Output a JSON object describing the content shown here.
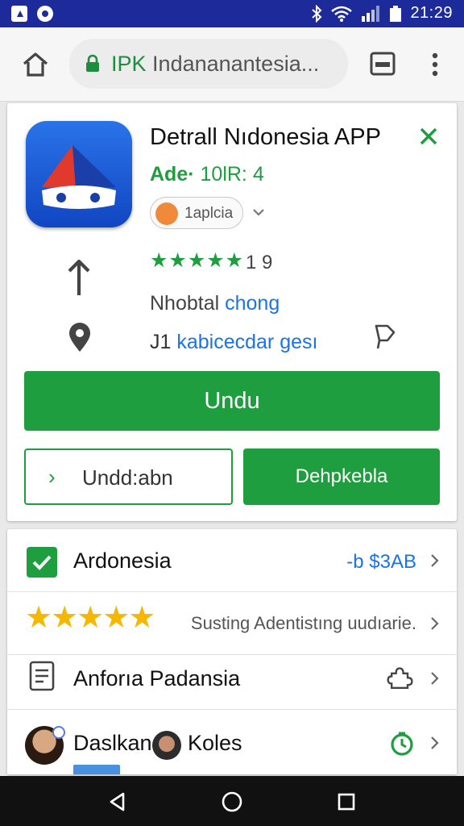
{
  "status_bar": {
    "time": "21:29",
    "icons": [
      "notification-square-icon",
      "notification-circle-icon",
      "bluetooth-icon",
      "wifi-icon",
      "signal-icon",
      "battery-icon"
    ]
  },
  "browser": {
    "url_prefix": "IPK",
    "url_text": "Indananantesia...",
    "icons": [
      "home-icon",
      "lock-icon",
      "tabs-icon",
      "more-vert-icon"
    ]
  },
  "app": {
    "title": "Detrall Nıdonesia APP",
    "subtitle_prefix": "Ade·",
    "subtitle_value": "10lR: 4",
    "chip_label": "1aplcia",
    "rating_stars": "★★★★★",
    "rating_count": "1 9",
    "info_prefix": "Nhobtal",
    "info_accent": "chong",
    "location_number": "J1",
    "location_text": "kabicecdar gesı",
    "install_label": "Undu",
    "secondary_left_label": "Undd:abn",
    "secondary_right_label": "Dehpkebla",
    "colors": {
      "accent_green": "#1e9e3e",
      "link_blue": "#1a73e8"
    }
  },
  "list": {
    "rows": [
      {
        "title": "Ardonesia",
        "right_text": "-b $3AB"
      },
      {
        "stars": "★★★★★",
        "right_text": "Susting Adentistıng uudıarie."
      },
      {
        "title": "Anforıa Padansia",
        "right_text": ""
      },
      {
        "title_a": "Daslkan",
        "title_b": "Koles",
        "right_text": ""
      }
    ]
  },
  "nav": {
    "icons": [
      "back-icon",
      "home-circle-icon",
      "recents-icon"
    ]
  }
}
